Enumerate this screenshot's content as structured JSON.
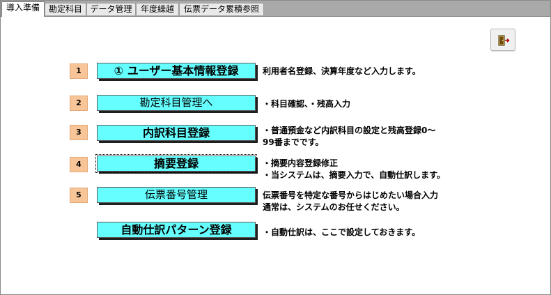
{
  "tabs": [
    {
      "label": "導入準備",
      "active": true
    },
    {
      "label": "勘定科目",
      "active": false
    },
    {
      "label": "データ管理",
      "active": false
    },
    {
      "label": "年度繰越",
      "active": false
    },
    {
      "label": "伝票データ累積参照",
      "active": false
    }
  ],
  "exit_button": {
    "icon": "exit-door-icon"
  },
  "steps": [
    {
      "number": "1",
      "button_label": "① ユーザー基本情報登録",
      "desc_lines": [
        "利用者名登録、決算年度など入力します。"
      ]
    },
    {
      "number": "2",
      "button_label": "勘定科目管理へ",
      "desc_lines": [
        "・科目確認、・残高入力"
      ]
    },
    {
      "number": "3",
      "button_label": "内訳科目登録",
      "desc_lines": [
        "・普通預金など内訳科目の設定と残高登録0～",
        "99番までです。"
      ]
    },
    {
      "number": "4",
      "button_label": "摘要登録",
      "desc_lines": [
        "・摘要内容登録修正",
        "・当システムは、摘要入力で、自動仕訳します。"
      ]
    },
    {
      "number": "5",
      "button_label": "伝票番号管理",
      "desc_lines": [
        "伝票番号を特定な番号からはじめたい場合入力",
        "通常は、システムのお任せください。"
      ]
    },
    {
      "number": "",
      "button_label": "自動仕訳パターン登録",
      "desc_lines": [
        "・自動仕訳は、ここで設定しておきます。"
      ]
    }
  ],
  "colors": {
    "button_bg": "#66ffff",
    "number_badge_bg": "#f7c597",
    "tabbar_bg": "#a9a9a9"
  }
}
